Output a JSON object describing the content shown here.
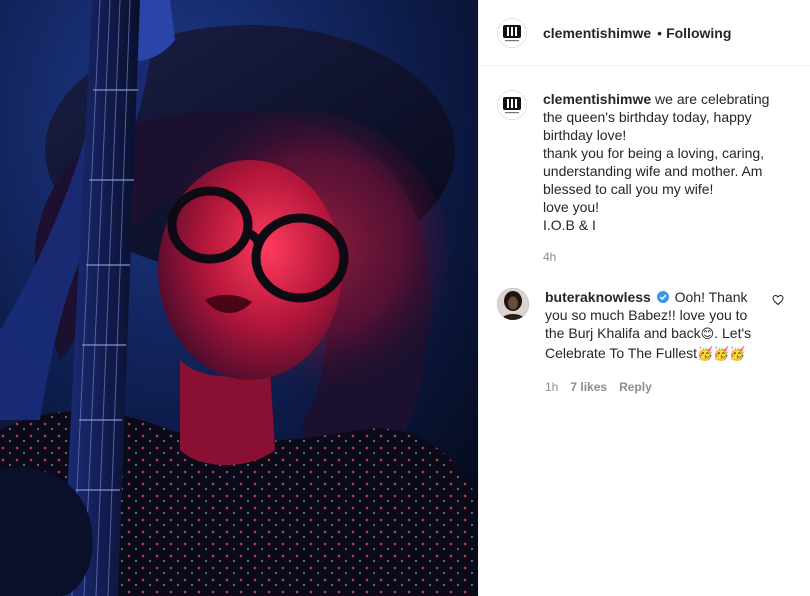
{
  "post": {
    "username": "clementishimwe",
    "separator": "•",
    "follow_status": "Following"
  },
  "caption": {
    "username": "clementishimwe",
    "line1": "we are celebrating the queen's birthday today, happy birthday love!",
    "line2": "thank you for being a loving, caring, understanding wife and mother. Am blessed to call you my wife!",
    "line3": "love you!",
    "line4": "I.O.B & I",
    "time": "4h"
  },
  "comment": {
    "username": "buteraknowless",
    "text": "Ooh! Thank you so much Babez!! love you to the Burj Khalifa and back",
    "emoji_smile": "😊",
    "text_after": ". Let's Celebrate To The Fullest",
    "emoji_party": "🥳🥳🥳",
    "time": "1h",
    "likes": "7 likes",
    "reply": "Reply"
  },
  "colors": {
    "verified": "#3897f0",
    "text": "#262626",
    "muted": "#8e8e8e",
    "border": "#efefef"
  },
  "icons": {
    "avatar_logo": "km-logo-icon",
    "verified": "verified-badge-icon",
    "like": "heart-icon"
  }
}
